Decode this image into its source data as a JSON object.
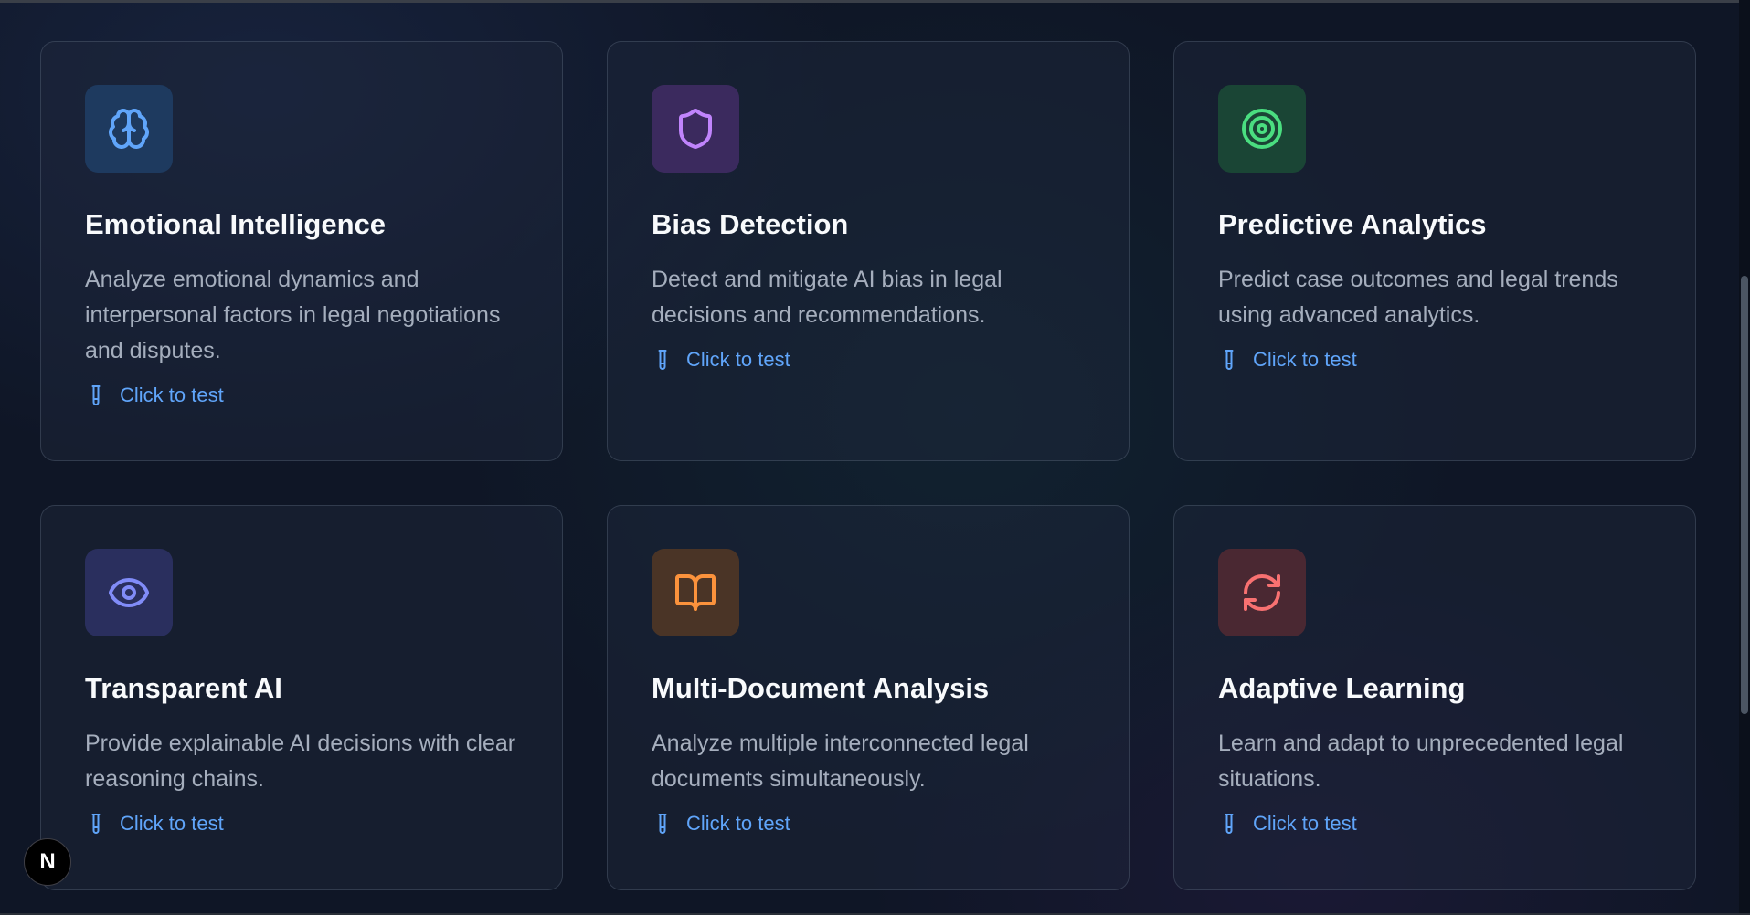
{
  "cards": [
    {
      "title": "Emotional Intelligence",
      "description": "Analyze emotional dynamics and interpersonal factors in legal negotiations and disputes.",
      "link": "Click to test",
      "icon": "brain-icon",
      "accent": "#60a5fa",
      "icon_bg": "#1e3a5f"
    },
    {
      "title": "Bias Detection",
      "description": "Detect and mitigate AI bias in legal decisions and recommendations.",
      "link": "Click to test",
      "icon": "shield-icon",
      "accent": "#c084fc",
      "icon_bg": "#3b2a5e"
    },
    {
      "title": "Predictive Analytics",
      "description": "Predict case outcomes and legal trends using advanced analytics.",
      "link": "Click to test",
      "icon": "target-icon",
      "accent": "#4ade80",
      "icon_bg": "#1a4535"
    },
    {
      "title": "Transparent AI",
      "description": "Provide explainable AI decisions with clear reasoning chains.",
      "link": "Click to test",
      "icon": "eye-icon",
      "accent": "#818cf8",
      "icon_bg": "#2a2f5e"
    },
    {
      "title": "Multi-Document Analysis",
      "description": "Analyze multiple interconnected legal documents simultaneously.",
      "link": "Click to test",
      "icon": "book-open-icon",
      "accent": "#fb923c",
      "icon_bg": "#4a3426"
    },
    {
      "title": "Adaptive Learning",
      "description": "Learn and adapt to unprecedented legal situations.",
      "link": "Click to test",
      "icon": "refresh-icon",
      "accent": "#f87171",
      "icon_bg": "#4a2832"
    }
  ],
  "badge": {
    "letter": "N"
  }
}
